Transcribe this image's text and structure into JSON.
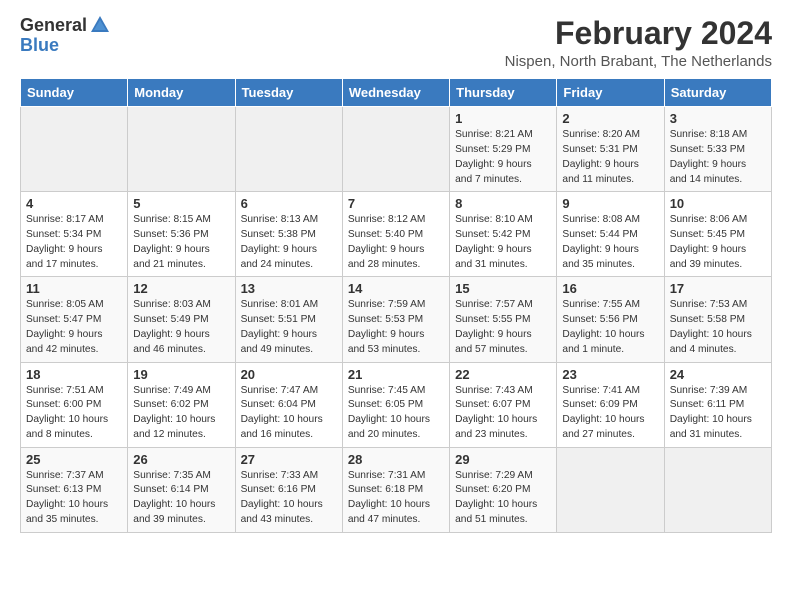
{
  "logo": {
    "general": "General",
    "blue": "Blue"
  },
  "title": "February 2024",
  "subtitle": "Nispen, North Brabant, The Netherlands",
  "headers": [
    "Sunday",
    "Monday",
    "Tuesday",
    "Wednesday",
    "Thursday",
    "Friday",
    "Saturday"
  ],
  "weeks": [
    [
      {
        "day": "",
        "info": ""
      },
      {
        "day": "",
        "info": ""
      },
      {
        "day": "",
        "info": ""
      },
      {
        "day": "",
        "info": ""
      },
      {
        "day": "1",
        "info": "Sunrise: 8:21 AM\nSunset: 5:29 PM\nDaylight: 9 hours\nand 7 minutes."
      },
      {
        "day": "2",
        "info": "Sunrise: 8:20 AM\nSunset: 5:31 PM\nDaylight: 9 hours\nand 11 minutes."
      },
      {
        "day": "3",
        "info": "Sunrise: 8:18 AM\nSunset: 5:33 PM\nDaylight: 9 hours\nand 14 minutes."
      }
    ],
    [
      {
        "day": "4",
        "info": "Sunrise: 8:17 AM\nSunset: 5:34 PM\nDaylight: 9 hours\nand 17 minutes."
      },
      {
        "day": "5",
        "info": "Sunrise: 8:15 AM\nSunset: 5:36 PM\nDaylight: 9 hours\nand 21 minutes."
      },
      {
        "day": "6",
        "info": "Sunrise: 8:13 AM\nSunset: 5:38 PM\nDaylight: 9 hours\nand 24 minutes."
      },
      {
        "day": "7",
        "info": "Sunrise: 8:12 AM\nSunset: 5:40 PM\nDaylight: 9 hours\nand 28 minutes."
      },
      {
        "day": "8",
        "info": "Sunrise: 8:10 AM\nSunset: 5:42 PM\nDaylight: 9 hours\nand 31 minutes."
      },
      {
        "day": "9",
        "info": "Sunrise: 8:08 AM\nSunset: 5:44 PM\nDaylight: 9 hours\nand 35 minutes."
      },
      {
        "day": "10",
        "info": "Sunrise: 8:06 AM\nSunset: 5:45 PM\nDaylight: 9 hours\nand 39 minutes."
      }
    ],
    [
      {
        "day": "11",
        "info": "Sunrise: 8:05 AM\nSunset: 5:47 PM\nDaylight: 9 hours\nand 42 minutes."
      },
      {
        "day": "12",
        "info": "Sunrise: 8:03 AM\nSunset: 5:49 PM\nDaylight: 9 hours\nand 46 minutes."
      },
      {
        "day": "13",
        "info": "Sunrise: 8:01 AM\nSunset: 5:51 PM\nDaylight: 9 hours\nand 49 minutes."
      },
      {
        "day": "14",
        "info": "Sunrise: 7:59 AM\nSunset: 5:53 PM\nDaylight: 9 hours\nand 53 minutes."
      },
      {
        "day": "15",
        "info": "Sunrise: 7:57 AM\nSunset: 5:55 PM\nDaylight: 9 hours\nand 57 minutes."
      },
      {
        "day": "16",
        "info": "Sunrise: 7:55 AM\nSunset: 5:56 PM\nDaylight: 10 hours\nand 1 minute."
      },
      {
        "day": "17",
        "info": "Sunrise: 7:53 AM\nSunset: 5:58 PM\nDaylight: 10 hours\nand 4 minutes."
      }
    ],
    [
      {
        "day": "18",
        "info": "Sunrise: 7:51 AM\nSunset: 6:00 PM\nDaylight: 10 hours\nand 8 minutes."
      },
      {
        "day": "19",
        "info": "Sunrise: 7:49 AM\nSunset: 6:02 PM\nDaylight: 10 hours\nand 12 minutes."
      },
      {
        "day": "20",
        "info": "Sunrise: 7:47 AM\nSunset: 6:04 PM\nDaylight: 10 hours\nand 16 minutes."
      },
      {
        "day": "21",
        "info": "Sunrise: 7:45 AM\nSunset: 6:05 PM\nDaylight: 10 hours\nand 20 minutes."
      },
      {
        "day": "22",
        "info": "Sunrise: 7:43 AM\nSunset: 6:07 PM\nDaylight: 10 hours\nand 23 minutes."
      },
      {
        "day": "23",
        "info": "Sunrise: 7:41 AM\nSunset: 6:09 PM\nDaylight: 10 hours\nand 27 minutes."
      },
      {
        "day": "24",
        "info": "Sunrise: 7:39 AM\nSunset: 6:11 PM\nDaylight: 10 hours\nand 31 minutes."
      }
    ],
    [
      {
        "day": "25",
        "info": "Sunrise: 7:37 AM\nSunset: 6:13 PM\nDaylight: 10 hours\nand 35 minutes."
      },
      {
        "day": "26",
        "info": "Sunrise: 7:35 AM\nSunset: 6:14 PM\nDaylight: 10 hours\nand 39 minutes."
      },
      {
        "day": "27",
        "info": "Sunrise: 7:33 AM\nSunset: 6:16 PM\nDaylight: 10 hours\nand 43 minutes."
      },
      {
        "day": "28",
        "info": "Sunrise: 7:31 AM\nSunset: 6:18 PM\nDaylight: 10 hours\nand 47 minutes."
      },
      {
        "day": "29",
        "info": "Sunrise: 7:29 AM\nSunset: 6:20 PM\nDaylight: 10 hours\nand 51 minutes."
      },
      {
        "day": "",
        "info": ""
      },
      {
        "day": "",
        "info": ""
      }
    ]
  ]
}
